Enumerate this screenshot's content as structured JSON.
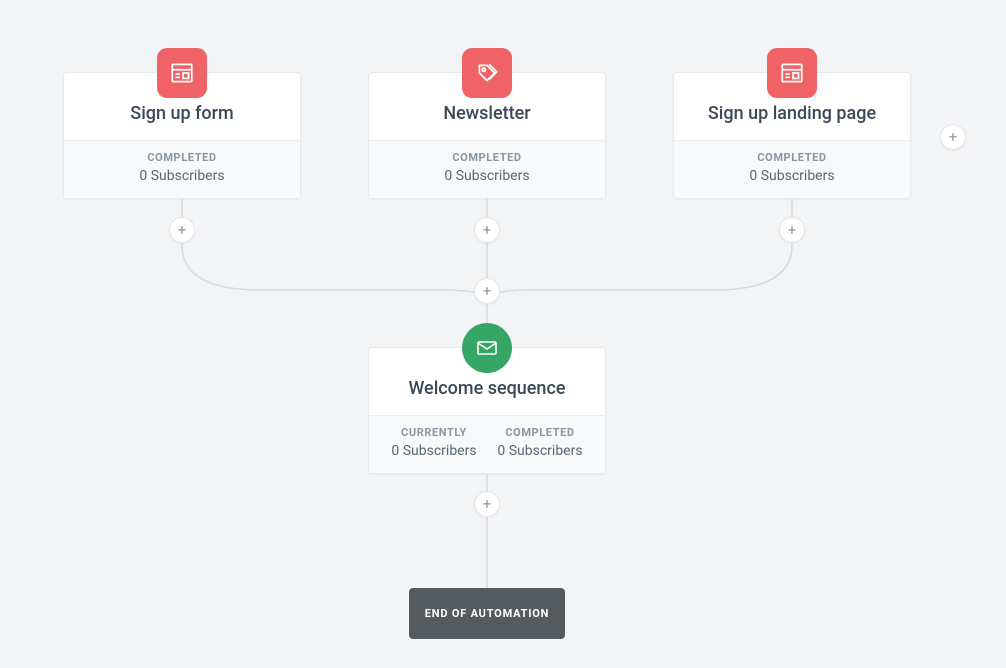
{
  "colors": {
    "red": "#ef6265",
    "green": "#35a665",
    "gray": "#555a5e"
  },
  "icons": {
    "form": "form-icon",
    "tag": "tag-icon",
    "envelope": "envelope-icon"
  },
  "entries": [
    {
      "title": "Sign up form",
      "icon": "form",
      "color": "red",
      "stats": [
        {
          "label": "COMPLETED",
          "value": "0 Subscribers"
        }
      ]
    },
    {
      "title": "Newsletter",
      "icon": "tag",
      "color": "red",
      "stats": [
        {
          "label": "COMPLETED",
          "value": "0 Subscribers"
        }
      ]
    },
    {
      "title": "Sign up landing page",
      "icon": "form",
      "color": "red",
      "stats": [
        {
          "label": "COMPLETED",
          "value": "0 Subscribers"
        }
      ]
    }
  ],
  "sequence": {
    "title": "Welcome sequence",
    "icon": "envelope",
    "color": "green",
    "stats": [
      {
        "label": "CURRENTLY",
        "value": "0 Subscribers"
      },
      {
        "label": "COMPLETED",
        "value": "0 Subscribers"
      }
    ]
  },
  "end_label": "END OF AUTOMATION",
  "plus_glyph": "+"
}
